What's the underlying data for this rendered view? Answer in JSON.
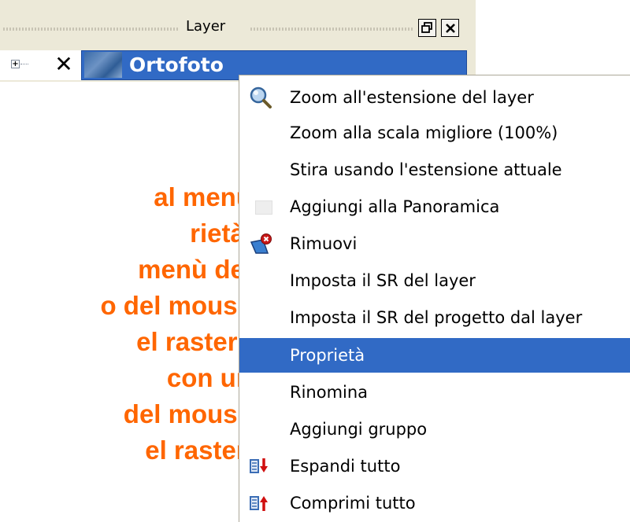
{
  "slide": {
    "lines": [
      "al menù",
      "rietà.",
      "menù del",
      "o del mouse",
      "el raster |",
      "con un",
      "del mouse",
      "el raster."
    ],
    "text_color": "#ff6600"
  },
  "layer_panel": {
    "title": "Layer",
    "float_button_icon": "restore-icon",
    "close_button_icon": "close-icon",
    "layer": {
      "name": "Ortofoto",
      "visible_toggle": "✕"
    },
    "selection_color": "#316ac5"
  },
  "context_menu": {
    "items": [
      {
        "label": "Zoom all'estensione del layer",
        "icon": "zoom-magnifier-icon"
      },
      {
        "label": "Zoom alla scala migliore (100%)",
        "icon": ""
      },
      {
        "label": "Stira usando l'estensione attuale",
        "icon": ""
      },
      {
        "label": "Aggiungi alla Panoramica",
        "icon": "checkbox-icon"
      },
      {
        "label": "Rimuovi",
        "icon": "remove-layer-icon"
      },
      {
        "label": "Imposta il SR del layer",
        "icon": ""
      },
      {
        "label": "Imposta il SR del progetto dal layer",
        "icon": ""
      },
      {
        "label": "Proprietà",
        "icon": "",
        "highlighted": true
      },
      {
        "label": "Rinomina",
        "icon": ""
      },
      {
        "label": "Aggiungi gruppo",
        "icon": ""
      },
      {
        "label": "Espandi tutto",
        "icon": "expand-all-icon"
      },
      {
        "label": "Comprimi tutto",
        "icon": "collapse-all-icon"
      }
    ]
  }
}
